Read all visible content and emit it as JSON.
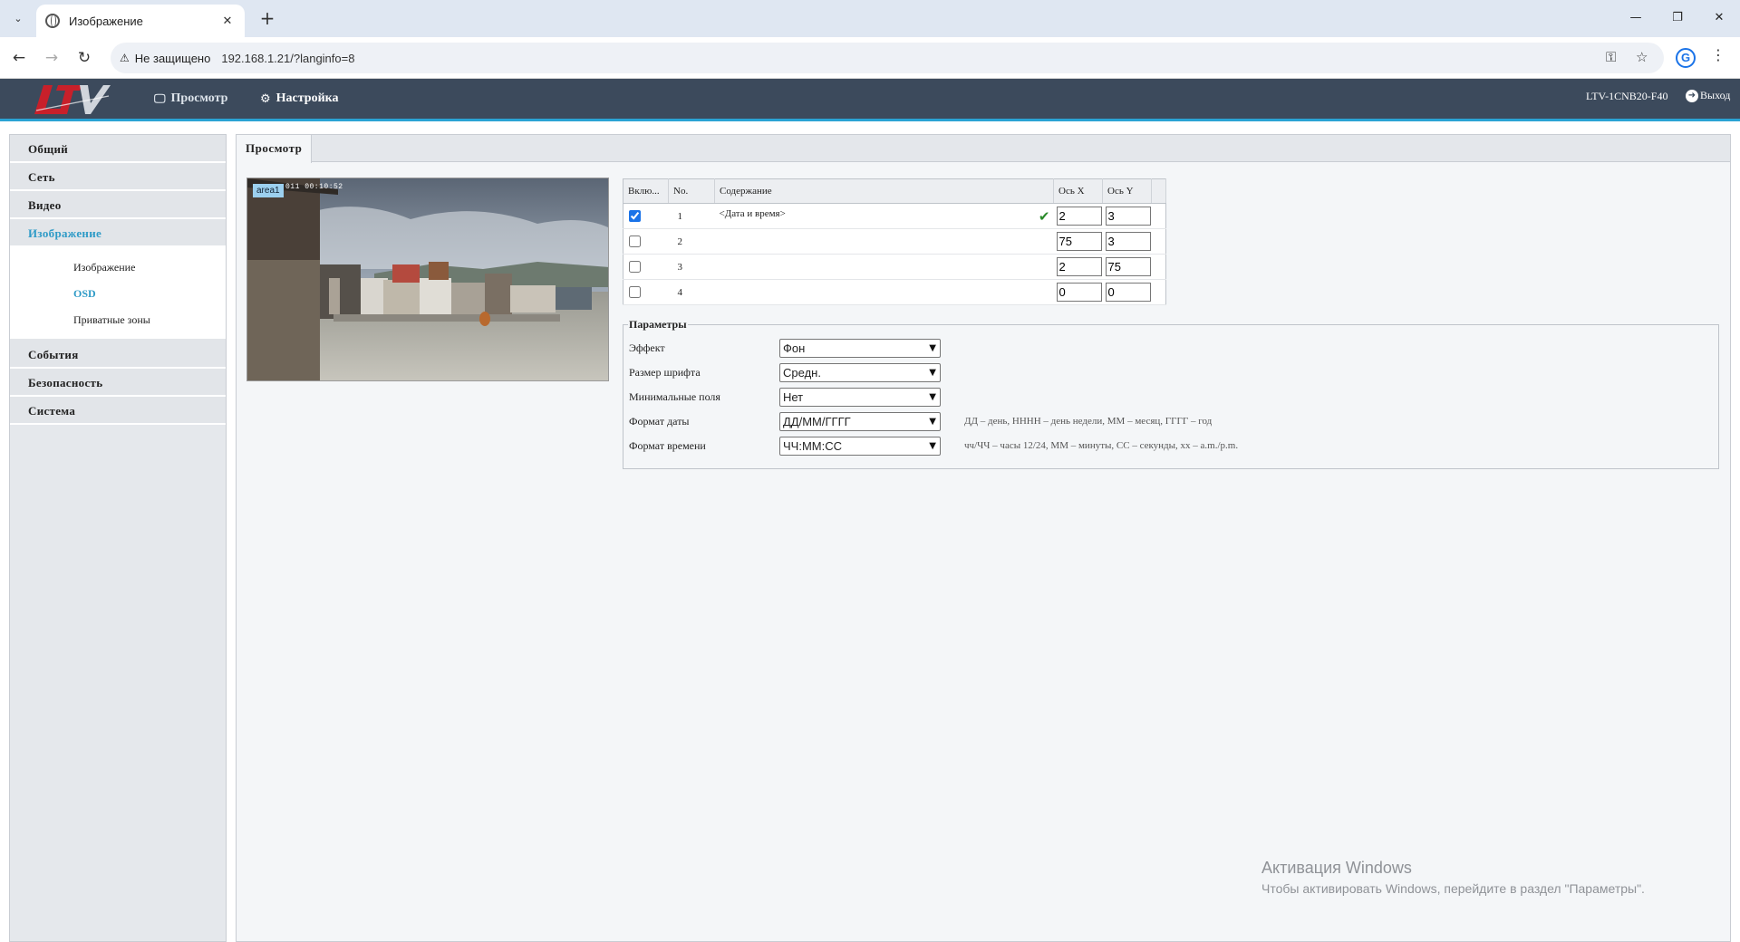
{
  "browser": {
    "tab_title": "Изображение",
    "security_label": "Не защищено",
    "url": "192.168.1.21/?langinfo=8",
    "profile_letter": "G"
  },
  "header": {
    "nav": [
      {
        "label": "Просмотр",
        "icon": "monitor-icon"
      },
      {
        "label": "Настройка",
        "icon": "gear-icon",
        "active": true
      }
    ],
    "device_name": "LTV-1CNB20-F40",
    "logout_label": "Выход",
    "accent": "#2aa3d4"
  },
  "sidebar": {
    "items": [
      {
        "label": "Общий"
      },
      {
        "label": "Сеть"
      },
      {
        "label": "Видео"
      },
      {
        "label": "Изображение",
        "active": true
      },
      {
        "label": "События"
      },
      {
        "label": "Безопасность"
      },
      {
        "label": "Система"
      }
    ],
    "sub_items": [
      {
        "label": "Изображение"
      },
      {
        "label": "OSD",
        "active": true
      },
      {
        "label": "Приватные зоны"
      }
    ]
  },
  "main": {
    "tab_label": "Просмотр",
    "preview": {
      "area_label": "area1",
      "osd_timestamp": "011 00:10:52"
    },
    "table": {
      "headers": [
        "Вклю...",
        "No.",
        "Содержание",
        "Ось X",
        "Ось Y"
      ],
      "rows": [
        {
          "enabled": true,
          "no": "1",
          "content": "<Дата и время>",
          "x": "2",
          "y": "3",
          "status": "check-icon"
        },
        {
          "enabled": false,
          "no": "2",
          "content": "",
          "x": "75",
          "y": "3"
        },
        {
          "enabled": false,
          "no": "3",
          "content": "",
          "x": "2",
          "y": "75"
        },
        {
          "enabled": false,
          "no": "4",
          "content": "",
          "x": "0",
          "y": "0"
        }
      ]
    },
    "params": {
      "legend": "Параметры",
      "rows": [
        {
          "label": "Эффект",
          "value": "Фон",
          "hint": ""
        },
        {
          "label": "Размер шрифта",
          "value": "Средн.",
          "hint": ""
        },
        {
          "label": "Минимальные поля",
          "value": "Нет",
          "hint": ""
        },
        {
          "label": "Формат даты",
          "value": "ДД/ММ/ГГГГ",
          "hint": "ДД – день, НННН – день недели, ММ – месяц, ГГГГ – год"
        },
        {
          "label": "Формат времени",
          "value": "ЧЧ:ММ:СС",
          "hint": "чч/ЧЧ – часы 12/24, ММ – минуты, СС – секунды, хх – a.m./p.m."
        }
      ]
    }
  },
  "watermark": {
    "line1": "Активация Windows",
    "line2": "Чтобы активировать Windows, перейдите в раздел \"Параметры\"."
  }
}
